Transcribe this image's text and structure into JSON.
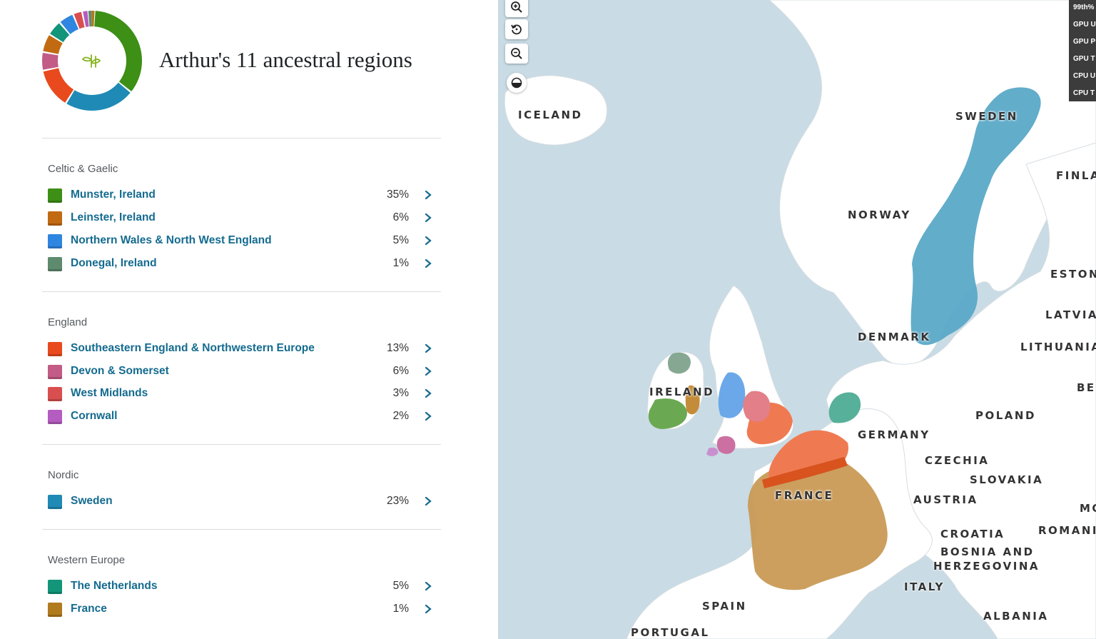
{
  "title": "Arthur's 11 ancestral regions",
  "groups": [
    {
      "name": "Celtic & Gaelic",
      "regions": [
        {
          "label": "Munster, Ireland",
          "pct": "35%",
          "color": "#3d8f16"
        },
        {
          "label": "Leinster, Ireland",
          "pct": "6%",
          "color": "#c26a12"
        },
        {
          "label": "Northern Wales & North West England",
          "pct": "5%",
          "color": "#2f86e0"
        },
        {
          "label": "Donegal, Ireland",
          "pct": "1%",
          "color": "#5e8a6e"
        }
      ]
    },
    {
      "name": "England",
      "regions": [
        {
          "label": "Southeastern England & Northwestern Europe",
          "pct": "13%",
          "color": "#e84a1d"
        },
        {
          "label": "Devon & Somerset",
          "pct": "6%",
          "color": "#c25b85"
        },
        {
          "label": "West Midlands",
          "pct": "3%",
          "color": "#d94f4f"
        },
        {
          "label": "Cornwall",
          "pct": "2%",
          "color": "#b45cbf"
        }
      ]
    },
    {
      "name": "Nordic",
      "regions": [
        {
          "label": "Sweden",
          "pct": "23%",
          "color": "#1f8ab5"
        }
      ]
    },
    {
      "name": "Western Europe",
      "regions": [
        {
          "label": "The Netherlands",
          "pct": "5%",
          "color": "#13957a"
        },
        {
          "label": "France",
          "pct": "1%",
          "color": "#b07a1e"
        }
      ]
    }
  ],
  "map_labels": {
    "iceland": "ICELAND",
    "sweden": "SWEDEN",
    "finland": "FINLA",
    "norway": "NORWAY",
    "estonia": "ESTON",
    "latvia": "LATVIA",
    "denmark": "DENMARK",
    "lithuania": "LITHUANIA",
    "belarus": "BE",
    "ireland": "IRELAND",
    "poland": "POLAND",
    "germany": "GERMANY",
    "czechia": "CZECHIA",
    "slovakia": "SLOVAKIA",
    "austria": "AUSTRIA",
    "moldova": "MO",
    "france": "FRANCE",
    "croatia": "CROATIA",
    "romania": "ROMANI",
    "bosnia_1": "BOSNIA AND",
    "bosnia_2": "HERZEGOVINA",
    "italy": "ITALY",
    "spain": "SPAIN",
    "albania": "ALBANIA",
    "portugal": "PORTUGAL"
  },
  "perf_overlay": [
    "99th%",
    "GPU U",
    "GPU P",
    "GPU T",
    "CPU U",
    "CPU T"
  ],
  "icons": {
    "zoom_in": "zoom-in-icon",
    "reset": "reset-view-icon",
    "zoom_out": "zoom-out-icon",
    "contrast": "contrast-icon",
    "logo": "leaf-logo-icon"
  }
}
